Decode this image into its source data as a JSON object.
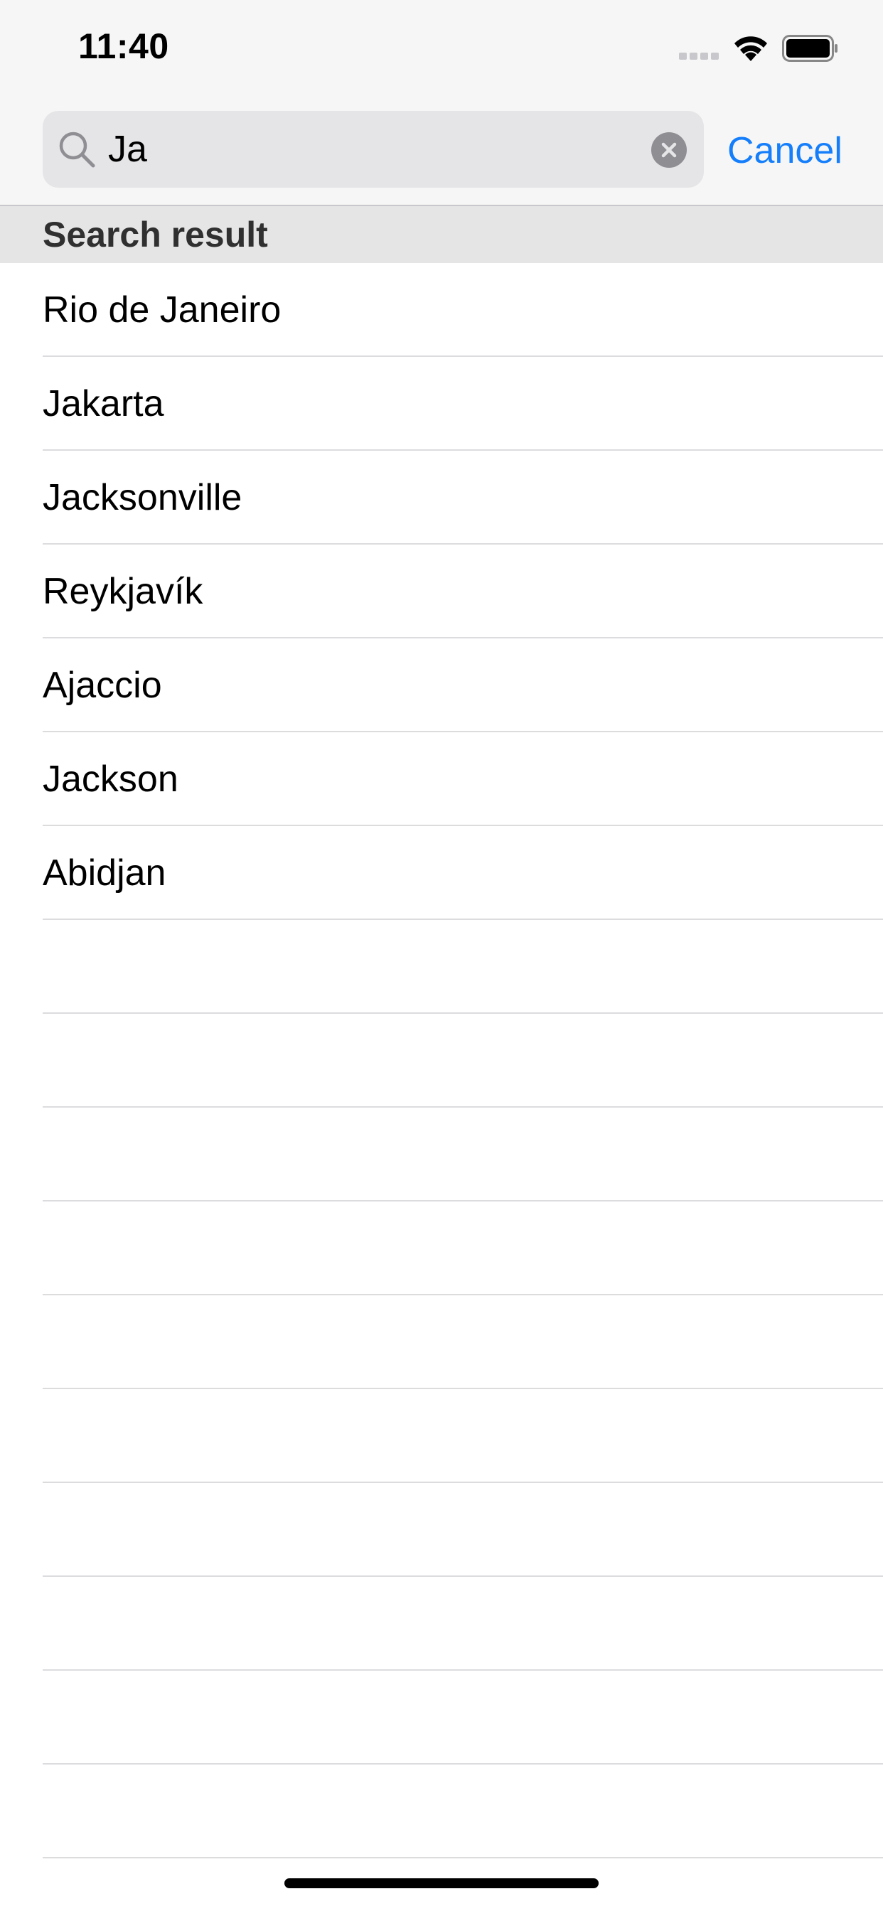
{
  "status_bar": {
    "time": "11:40"
  },
  "search": {
    "value": "Ja",
    "cancel_label": "Cancel"
  },
  "section": {
    "title": "Search result"
  },
  "results": [
    "Rio de Janeiro",
    "Jakarta",
    "Jacksonville",
    "Reykjavík",
    "Ajaccio",
    "Jackson",
    "Abidjan"
  ],
  "empty_rows": 10,
  "colors": {
    "accent": "#157efb",
    "separator": "#dcdcdf",
    "header_bg": "#e5e5e5"
  },
  "icons": [
    "signal-icon",
    "wifi-icon",
    "battery-icon",
    "search-icon",
    "clear-icon"
  ]
}
